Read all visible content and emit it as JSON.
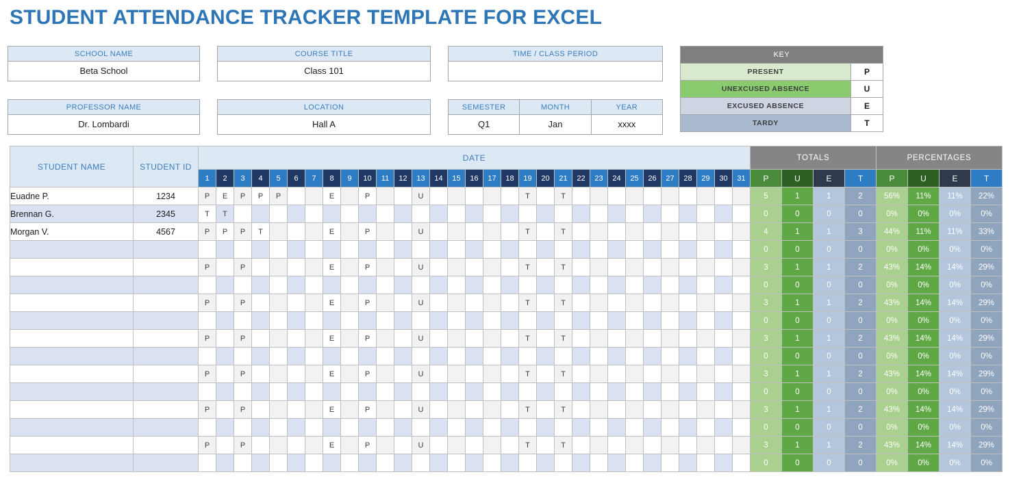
{
  "title": "STUDENT ATTENDANCE TRACKER TEMPLATE FOR EXCEL",
  "colors": {
    "title": "#2E75B6",
    "info_header_bg": "#DCE9F5",
    "key_title_bg": "#7F7F7F",
    "present": "#D8E9CE",
    "unexcused": "#8ACB6F",
    "excused": "#CDD5E2",
    "tardy": "#AAB9CE",
    "day_odd": "#2E7CC4",
    "day_even": "#1F3864",
    "totals_band": "#858585",
    "sum_P": "#A9D08E",
    "sum_U": "#5FA845",
    "sum_E": "#B4C6DC",
    "sum_T": "#8FA5BE"
  },
  "info": {
    "school_name": {
      "label": "SCHOOL NAME",
      "value": "Beta School"
    },
    "course_title": {
      "label": "COURSE TITLE",
      "value": "Class 101"
    },
    "time_period": {
      "label": "TIME / CLASS PERIOD",
      "value": ""
    },
    "professor_name": {
      "label": "PROFESSOR NAME",
      "value": "Dr. Lombardi"
    },
    "location": {
      "label": "LOCATION",
      "value": "Hall A"
    },
    "semester": {
      "label": "SEMESTER",
      "value": "Q1"
    },
    "month": {
      "label": "MONTH",
      "value": "Jan"
    },
    "year": {
      "label": "YEAR",
      "value": "xxxx"
    }
  },
  "key": {
    "title": "KEY",
    "rows": [
      {
        "label": "PRESENT",
        "code": "P",
        "bg": "#D8E9CE"
      },
      {
        "label": "UNEXCUSED ABSENCE",
        "code": "U",
        "bg": "#8ACB6F"
      },
      {
        "label": "EXCUSED ABSENCE",
        "code": "E",
        "bg": "#CDD5E2"
      },
      {
        "label": "TARDY",
        "code": "T",
        "bg": "#AAB9CE"
      }
    ]
  },
  "table": {
    "headers": {
      "student_name": "STUDENT NAME",
      "student_id": "STUDENT ID",
      "date": "DATE",
      "totals": "TOTALS",
      "percentages": "PERCENTAGES",
      "sub": [
        "P",
        "U",
        "E",
        "T"
      ]
    },
    "days": [
      1,
      2,
      3,
      4,
      5,
      6,
      7,
      8,
      9,
      10,
      11,
      12,
      13,
      14,
      15,
      16,
      17,
      18,
      19,
      20,
      21,
      22,
      23,
      24,
      25,
      26,
      27,
      28,
      29,
      30,
      31
    ],
    "rows": [
      {
        "name": "Euadne P.",
        "id": "1234",
        "marks": {
          "1": "P",
          "2": "E",
          "3": "P",
          "4": "P",
          "5": "P",
          "8": "E",
          "10": "P",
          "13": "U",
          "19": "T",
          "21": "T"
        },
        "totals": [
          "5",
          "1",
          "1",
          "2"
        ],
        "percentages": [
          "56%",
          "11%",
          "11%",
          "22%"
        ]
      },
      {
        "name": "Brennan G.",
        "id": "2345",
        "marks": {
          "1": "T",
          "2": "T"
        },
        "totals": [
          "0",
          "0",
          "0",
          "0"
        ],
        "percentages": [
          "0%",
          "0%",
          "0%",
          "0%"
        ]
      },
      {
        "name": "Morgan V.",
        "id": "4567",
        "marks": {
          "1": "P",
          "2": "P",
          "3": "P",
          "4": "T",
          "8": "E",
          "10": "P",
          "13": "U",
          "19": "T",
          "21": "T"
        },
        "totals": [
          "4",
          "1",
          "1",
          "3"
        ],
        "percentages": [
          "44%",
          "11%",
          "11%",
          "33%"
        ]
      },
      {
        "name": "",
        "id": "",
        "marks": {},
        "totals": [
          "0",
          "0",
          "0",
          "0"
        ],
        "percentages": [
          "0%",
          "0%",
          "0%",
          "0%"
        ]
      },
      {
        "name": "",
        "id": "",
        "marks": {
          "1": "P",
          "3": "P",
          "8": "E",
          "10": "P",
          "13": "U",
          "19": "T",
          "21": "T"
        },
        "totals": [
          "3",
          "1",
          "1",
          "2"
        ],
        "percentages": [
          "43%",
          "14%",
          "14%",
          "29%"
        ]
      },
      {
        "name": "",
        "id": "",
        "marks": {},
        "totals": [
          "0",
          "0",
          "0",
          "0"
        ],
        "percentages": [
          "0%",
          "0%",
          "0%",
          "0%"
        ]
      },
      {
        "name": "",
        "id": "",
        "marks": {
          "1": "P",
          "3": "P",
          "8": "E",
          "10": "P",
          "13": "U",
          "19": "T",
          "21": "T"
        },
        "totals": [
          "3",
          "1",
          "1",
          "2"
        ],
        "percentages": [
          "43%",
          "14%",
          "14%",
          "29%"
        ]
      },
      {
        "name": "",
        "id": "",
        "marks": {},
        "totals": [
          "0",
          "0",
          "0",
          "0"
        ],
        "percentages": [
          "0%",
          "0%",
          "0%",
          "0%"
        ]
      },
      {
        "name": "",
        "id": "",
        "marks": {
          "1": "P",
          "3": "P",
          "8": "E",
          "10": "P",
          "13": "U",
          "19": "T",
          "21": "T"
        },
        "totals": [
          "3",
          "1",
          "1",
          "2"
        ],
        "percentages": [
          "43%",
          "14%",
          "14%",
          "29%"
        ]
      },
      {
        "name": "",
        "id": "",
        "marks": {},
        "totals": [
          "0",
          "0",
          "0",
          "0"
        ],
        "percentages": [
          "0%",
          "0%",
          "0%",
          "0%"
        ]
      },
      {
        "name": "",
        "id": "",
        "marks": {
          "1": "P",
          "3": "P",
          "8": "E",
          "10": "P",
          "13": "U",
          "19": "T",
          "21": "T"
        },
        "totals": [
          "3",
          "1",
          "1",
          "2"
        ],
        "percentages": [
          "43%",
          "14%",
          "14%",
          "29%"
        ]
      },
      {
        "name": "",
        "id": "",
        "marks": {},
        "totals": [
          "0",
          "0",
          "0",
          "0"
        ],
        "percentages": [
          "0%",
          "0%",
          "0%",
          "0%"
        ]
      },
      {
        "name": "",
        "id": "",
        "marks": {
          "1": "P",
          "3": "P",
          "8": "E",
          "10": "P",
          "13": "U",
          "19": "T",
          "21": "T"
        },
        "totals": [
          "3",
          "1",
          "1",
          "2"
        ],
        "percentages": [
          "43%",
          "14%",
          "14%",
          "29%"
        ]
      },
      {
        "name": "",
        "id": "",
        "marks": {},
        "totals": [
          "0",
          "0",
          "0",
          "0"
        ],
        "percentages": [
          "0%",
          "0%",
          "0%",
          "0%"
        ]
      },
      {
        "name": "",
        "id": "",
        "marks": {
          "1": "P",
          "3": "P",
          "8": "E",
          "10": "P",
          "13": "U",
          "19": "T",
          "21": "T"
        },
        "totals": [
          "3",
          "1",
          "1",
          "2"
        ],
        "percentages": [
          "43%",
          "14%",
          "14%",
          "29%"
        ]
      },
      {
        "name": "",
        "id": "",
        "marks": {},
        "totals": [
          "0",
          "0",
          "0",
          "0"
        ],
        "percentages": [
          "0%",
          "0%",
          "0%",
          "0%"
        ]
      }
    ]
  }
}
